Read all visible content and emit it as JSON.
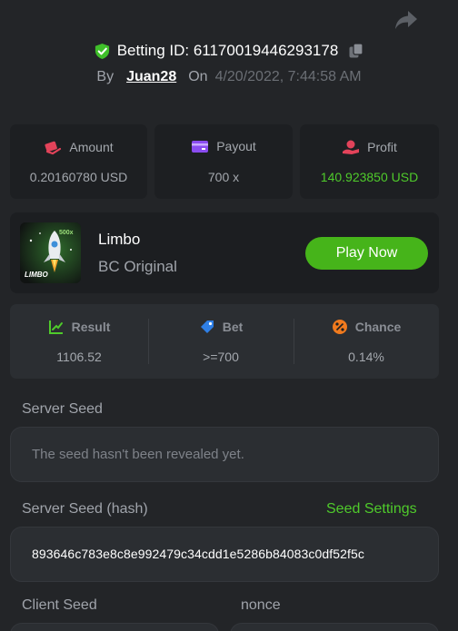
{
  "header": {
    "betting_id_label": "Betting ID: 61170019446293178",
    "by_label": "By",
    "username": "Juan28",
    "on_label": "On",
    "date": "4/20/2022, 7:44:58 AM"
  },
  "stats": {
    "amount": {
      "label": "Amount",
      "value": "0.20160780 USD"
    },
    "payout": {
      "label": "Payout",
      "value": "700 x"
    },
    "profit": {
      "label": "Profit",
      "value": "140.923850 USD"
    }
  },
  "game": {
    "name": "Limbo",
    "subtitle": "BC Original",
    "thumb_label": "LIMBO",
    "thumb_badge": "500x",
    "play_label": "Play Now"
  },
  "result": {
    "result": {
      "label": "Result",
      "value": "1106.52"
    },
    "bet": {
      "label": "Bet",
      "value": ">=700"
    },
    "chance": {
      "label": "Chance",
      "value": "0.14%"
    }
  },
  "seeds": {
    "server_seed_label": "Server Seed",
    "server_seed_placeholder": "The seed hasn't been revealed yet.",
    "server_seed_hash_label": "Server Seed (hash)",
    "seed_settings_label": "Seed Settings",
    "server_seed_hash": "893646c783e8c8e992479c34cdd1e5286b84083c0df52f5c",
    "client_seed_label": "Client Seed",
    "nonce_label": "nonce"
  },
  "colors": {
    "background": "#232528",
    "card": "#1d1f22",
    "accent_green": "#46b41a",
    "profit_green": "#4fca2b"
  }
}
